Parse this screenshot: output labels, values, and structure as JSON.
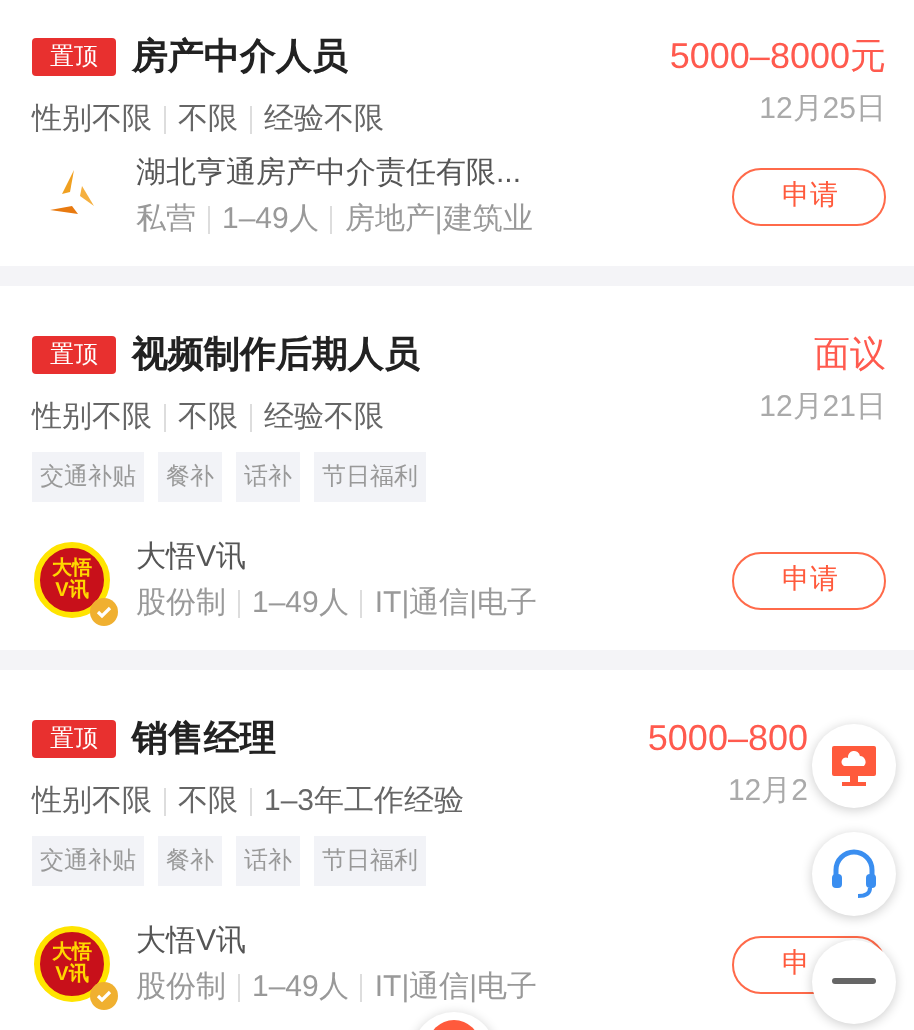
{
  "jobs": [
    {
      "pin_label": "置顶",
      "title": "房产中介人员",
      "salary": "5000–8000元",
      "attributes": [
        "性别不限",
        "不限",
        "经验不限"
      ],
      "date": "12月25日",
      "company": {
        "name": "湖北亨通房产中介责任有限...",
        "logo": {
          "kind": "triangle"
        },
        "verified": false,
        "meta": [
          "私营",
          "1–49人",
          "房地产|建筑业"
        ]
      },
      "apply_button": "申请"
    },
    {
      "pin_label": "置顶",
      "title": "视频制作后期人员",
      "salary": "面议",
      "attributes": [
        "性别不限",
        "不限",
        "经验不限"
      ],
      "date": "12月21日",
      "benefits": [
        "交通补贴",
        "餐补",
        "话补",
        "节日福利"
      ],
      "company": {
        "name": "大悟V讯",
        "logo": {
          "kind": "badge",
          "text": [
            "大悟",
            "V讯"
          ]
        },
        "verified": true,
        "meta": [
          "股份制",
          "1–49人",
          "IT|通信|电子"
        ]
      },
      "apply_button": "申请"
    },
    {
      "pin_label": "置顶",
      "title": "销售经理",
      "salary": "5000–800",
      "attributes": [
        "性别不限",
        "不限",
        "1–3年工作经验"
      ],
      "date": "12月2",
      "benefits": [
        "交通补贴",
        "餐补",
        "话补",
        "节日福利"
      ],
      "company": {
        "name": "大悟V讯",
        "logo": {
          "kind": "badge",
          "text": [
            "大悟",
            "V讯"
          ]
        },
        "verified": true,
        "meta": [
          "股份制",
          "1–49人",
          "IT|通信|电子"
        ]
      },
      "apply_button": "申"
    }
  ],
  "floating_buttons": [
    {
      "kind": "monitor"
    },
    {
      "kind": "headset"
    },
    {
      "kind": "menu"
    },
    {
      "kind": "partial"
    }
  ]
}
